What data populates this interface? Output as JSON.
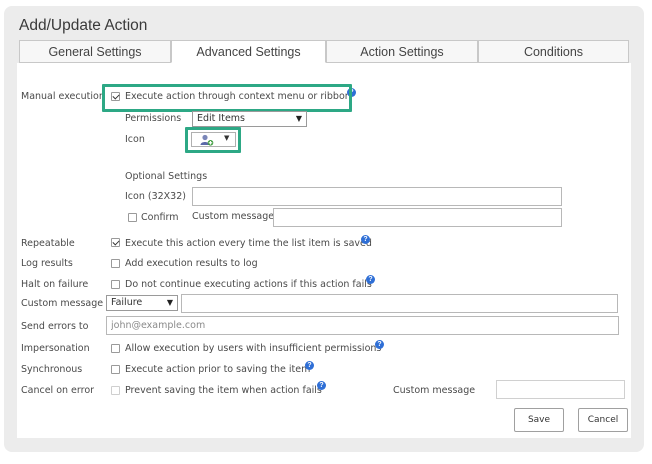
{
  "window": {
    "title": "Add/Update Action"
  },
  "tabs": [
    {
      "label": "General Settings"
    },
    {
      "label": "Advanced Settings"
    },
    {
      "label": "Action Settings"
    },
    {
      "label": "Conditions"
    }
  ],
  "active_tab": "Advanced Settings",
  "manual_execution": {
    "label": "Manual execution",
    "checkbox_label": "Execute action through context menu or ribbon",
    "checked": true,
    "permissions_label": "Permissions",
    "permissions_value": "Edit Items",
    "icon_label": "Icon",
    "icon_name": "user-add-icon",
    "optional_settings_label": "Optional Settings",
    "icon_32_label": "Icon (32X32)",
    "icon_32_value": "",
    "confirm_label": "Confirm",
    "confirm_checked": false,
    "custom_message_label": "Custom message",
    "custom_message_value": ""
  },
  "repeatable": {
    "label": "Repeatable",
    "text": "Execute this action every time the list item is saved",
    "checked": true
  },
  "log_results": {
    "label": "Log results",
    "text": "Add execution results to log",
    "checked": false
  },
  "halt_on_failure": {
    "label": "Halt on failure",
    "text": "Do not continue executing actions if this action fails",
    "checked": false
  },
  "custom_message": {
    "label": "Custom message",
    "type_value": "Failure",
    "value": ""
  },
  "send_errors": {
    "label": "Send errors to",
    "placeholder": "john@example.com"
  },
  "impersonation": {
    "label": "Impersonation",
    "text": "Allow execution by users with insufficient permissions",
    "checked": false
  },
  "synchronous": {
    "label": "Synchronous",
    "text": "Execute action prior to saving the item",
    "checked": false
  },
  "cancel_on_error": {
    "label": "Cancel on error",
    "text": "Prevent saving the item when action fails",
    "checked": false,
    "custom_message_label": "Custom message",
    "custom_message_value": ""
  },
  "buttons": {
    "save": "Save",
    "cancel": "Cancel"
  },
  "help_glyph": "?",
  "colors": {
    "highlight": "#2da885",
    "help": "#2f6fd6",
    "panel": "#ececec"
  }
}
